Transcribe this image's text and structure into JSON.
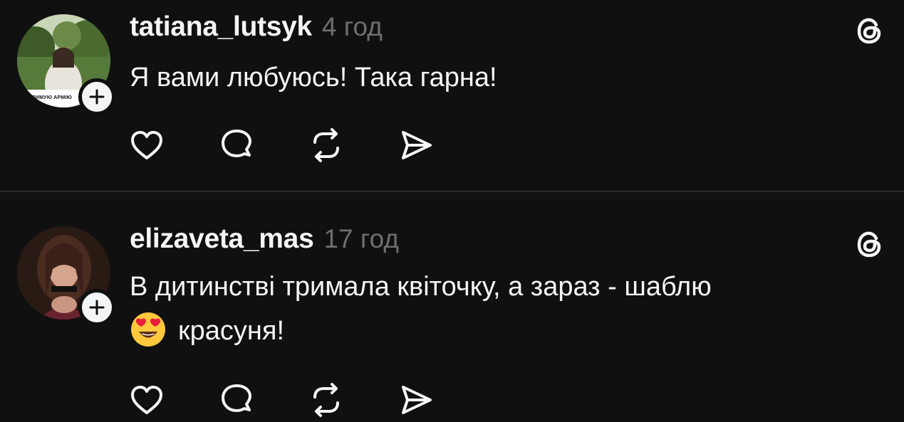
{
  "posts": [
    {
      "username": "tatiana_lutsyk",
      "time": "4 год",
      "text": "Я вами любуюсь! Така гарна!",
      "avatar_caption": "ПІДТРИМУЮ АРМІЮ"
    },
    {
      "username": "elizaveta_mas",
      "time": "17 год",
      "text_line1": "В дитинстві тримала квіточку, а зараз - шаблю",
      "text_line2": "красуня!",
      "emoji": "heart-eyes-emoji"
    }
  ],
  "icons": {
    "follow": "plus-icon",
    "brand": "threads-logo-icon",
    "like": "heart-icon",
    "reply": "comment-icon",
    "repost": "repost-icon",
    "share": "send-icon"
  },
  "colors": {
    "background": "#101010",
    "text": "#f3f5f7",
    "muted": "#6f6f6f",
    "divider": "#2a2a2a"
  }
}
